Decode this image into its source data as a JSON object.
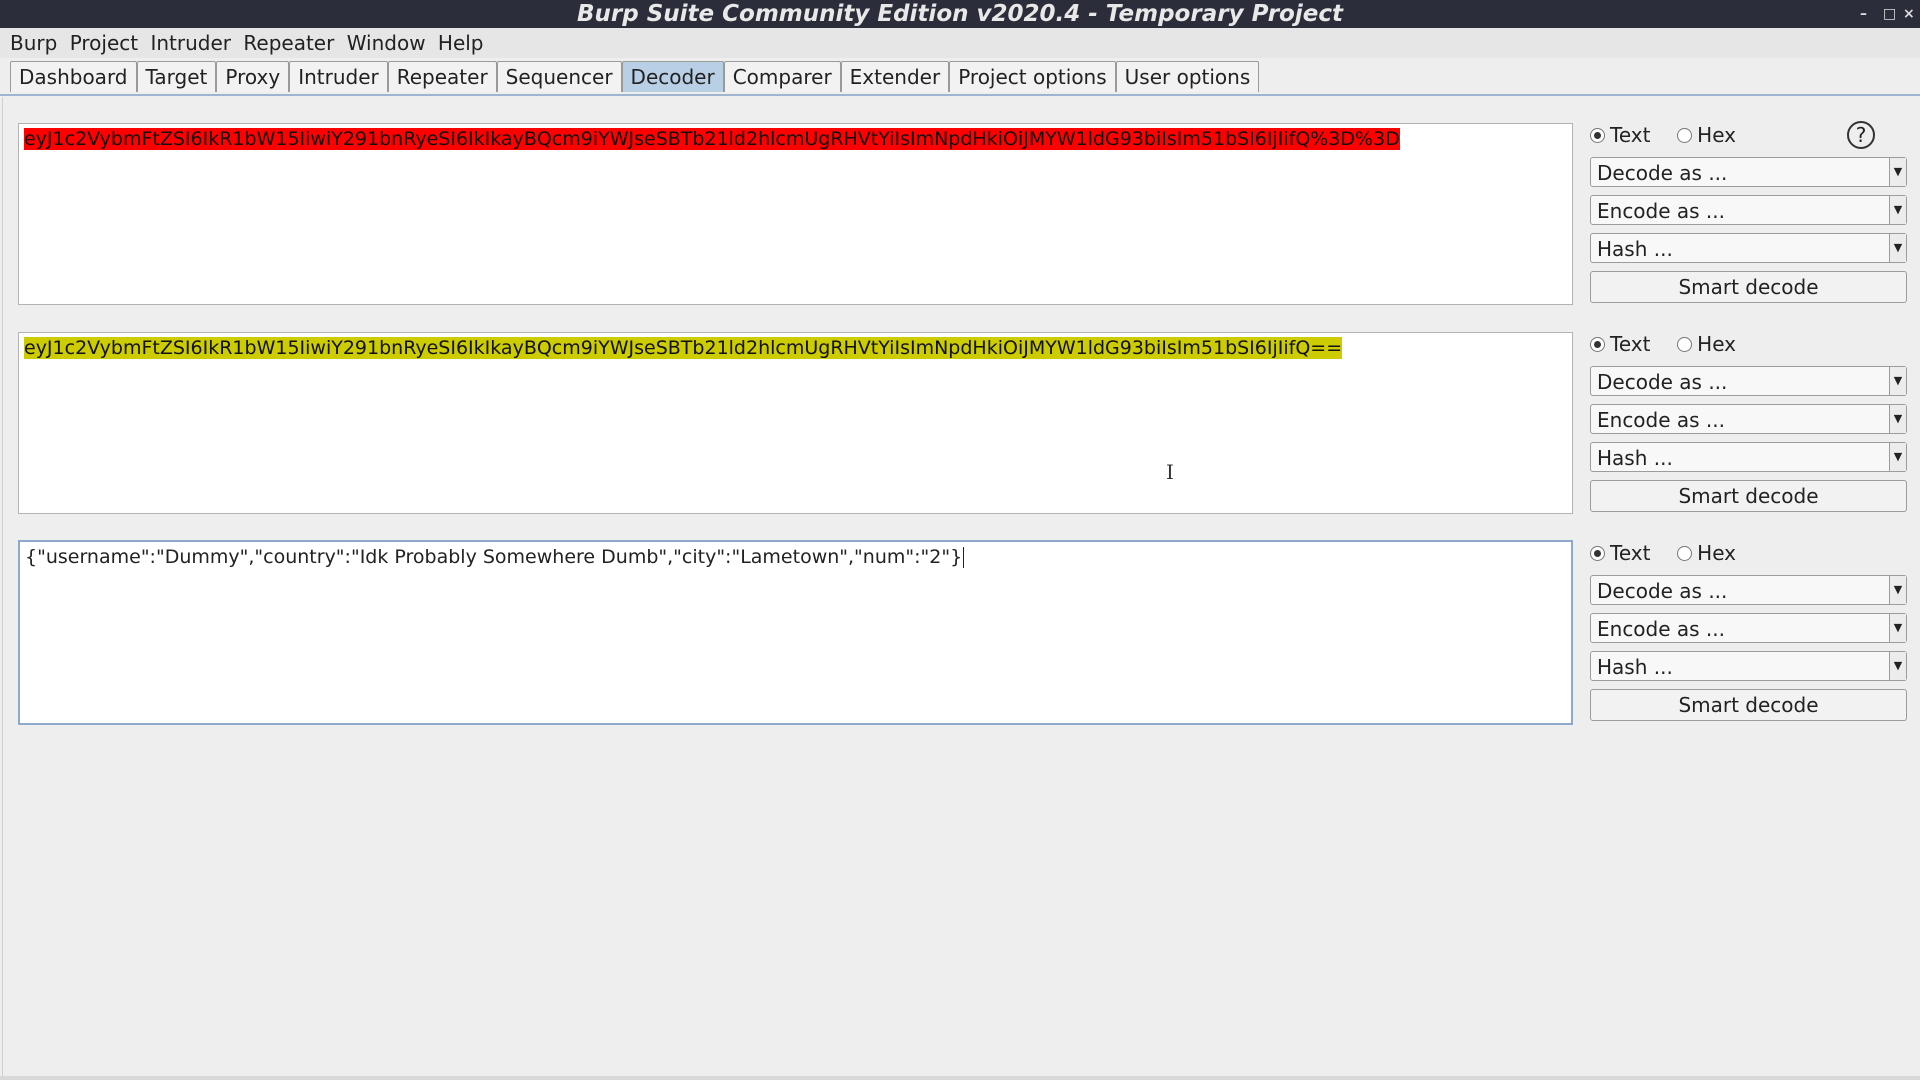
{
  "window": {
    "title": "Burp Suite Community Edition v2020.4 - Temporary Project",
    "controls": [
      "–",
      "□",
      "×"
    ]
  },
  "menu": [
    "Burp",
    "Project",
    "Intruder",
    "Repeater",
    "Window",
    "Help"
  ],
  "tabs": [
    {
      "label": "Dashboard"
    },
    {
      "label": "Target"
    },
    {
      "label": "Proxy"
    },
    {
      "label": "Intruder"
    },
    {
      "label": "Repeater"
    },
    {
      "label": "Sequencer"
    },
    {
      "label": "Decoder",
      "active": true
    },
    {
      "label": "Comparer"
    },
    {
      "label": "Extender"
    },
    {
      "label": "Project options"
    },
    {
      "label": "User options"
    }
  ],
  "decoder": {
    "panels": [
      {
        "text": "eyJ1c2VybmFtZSI6IkR1bW15IiwiY291bnRyeSI6IkIkayBQcm9iYWJseSBTb21ld2hlcmUgRHVtYiIsImNpdHkiOiJMYW1ldG93biIsIm51bSI6IjIifQ%3D%3D",
        "highlight": "#ff0000",
        "mode_text": "Text",
        "mode_hex": "Hex",
        "selected_mode": "Text",
        "decode_label": "Decode as ...",
        "encode_label": "Encode as ...",
        "hash_label": "Hash ...",
        "smart_label": "Smart decode"
      },
      {
        "text": "eyJ1c2VybmFtZSI6IkR1bW15IiwiY291bnRyeSI6IkIkayBQcm9iYWJseSBTb21ld2hlcmUgRHVtYiIsImNpdHkiOiJMYW1ldG93biIsIm51bSI6IjIifQ==",
        "highlight": "#cccc00",
        "mode_text": "Text",
        "mode_hex": "Hex",
        "selected_mode": "Text",
        "decode_label": "Decode as ...",
        "encode_label": "Encode as ...",
        "hash_label": "Hash ...",
        "smart_label": "Smart decode"
      },
      {
        "text": "{\"username\":\"Dummy\",\"country\":\"Idk Probably Somewhere Dumb\",\"city\":\"Lametown\",\"num\":\"2\"}",
        "highlight": "",
        "mode_text": "Text",
        "mode_hex": "Hex",
        "selected_mode": "Text",
        "decode_label": "Decode as ...",
        "encode_label": "Encode as ...",
        "hash_label": "Hash ...",
        "smart_label": "Smart decode"
      }
    ],
    "help_icon": "?"
  }
}
